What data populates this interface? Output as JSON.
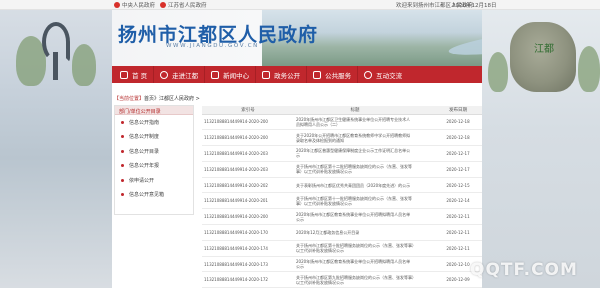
{
  "topbar": {
    "items": [
      "中央人民政府",
      "江苏省人民政府",
      "欢迎来到扬州市江都区人民政府",
      "2020年12月18日"
    ]
  },
  "banner": {
    "title": "扬州市江都区人民政府",
    "subtitle": "WWW.JIANGDU.GOV.CN",
    "stone_text": "江都"
  },
  "nav": {
    "items": [
      {
        "label": "首 页",
        "icon": "home-icon"
      },
      {
        "label": "走进江都",
        "icon": "info-icon"
      },
      {
        "label": "新闻中心",
        "icon": "news-icon"
      },
      {
        "label": "政务公开",
        "icon": "document-icon"
      },
      {
        "label": "公共服务",
        "icon": "service-icon"
      },
      {
        "label": "互动交流",
        "icon": "chat-icon"
      }
    ]
  },
  "breadcrumb": {
    "current": "【当前位置】",
    "path": "首页》江都区人民政府 >"
  },
  "sidebar": {
    "title": "部门/单位公开目录",
    "items": [
      "信息公开指南",
      "信息公开制度",
      "信息公开目录",
      "信息公开年报",
      "依申请公开",
      "信息公开意见箱"
    ]
  },
  "table": {
    "headers": [
      "索引号",
      "标题",
      "",
      "发布日期"
    ],
    "rows": [
      {
        "index": "11321088814449914-2020-200",
        "title": "2020年扬州市江都区卫生健康系统事业单位公开招聘专业技术人员拟聘用人员公示（二）",
        "date": "2020-12-18"
      },
      {
        "index": "11321088814449914-2020-200",
        "title": "关于2020年公开招聘市江都区教育系统教师中学公开招聘教师拟录取名单及体检报到的通知",
        "date": "2020-12-18"
      },
      {
        "index": "11321088814449914-2020-203",
        "title": "2020年江都区普惠型健康保障制度企业公示工作证明汇总名单公示",
        "date": "2020-12-17"
      },
      {
        "index": "11321088814449914-2020-203",
        "title": "关于扬州市江都区第十二批招聘服务缺岗位的公示（东营、张发等事）以工代训补贴发放情况公示",
        "date": "2020-12-17"
      },
      {
        "index": "11321088814449914-2020-202",
        "title": "关于表彰扬州市江都区优秀共青团团员（2020年度先进）的公示",
        "date": "2020-12-15"
      },
      {
        "index": "11321088814449914-2020-201",
        "title": "关于扬州市江都区第十一批招聘服务缺岗位的公示（东营、张发等事）以工代训补贴发放情况公示",
        "date": "2020-12-14"
      },
      {
        "index": "11321088814449914-2020-200",
        "title": "2020年扬州市江都区教育系统事业单位公开招聘拟聘用人员名单公示",
        "date": "2020-12-11"
      },
      {
        "index": "11321088814449914-2020-170",
        "title": "2020年12月江都政务信息公开目录",
        "date": "2020-12-11"
      },
      {
        "index": "11321088814449914-2020-174",
        "title": "关于扬州市江都区第十批招聘服务缺岗位的公示（东营、张发等事）以工代训补贴发放情况公示",
        "date": "2020-12-11"
      },
      {
        "index": "11321088814449914-2020-173",
        "title": "2020年扬州市江都区教育系统事业单位公开招聘拟聘用人员名单公示",
        "date": "2020-12-10"
      },
      {
        "index": "11321088814449914-2020-172",
        "title": "关于扬州市江都区第九批招聘服务缺岗位的公示（东营、张发等事）以工代训补贴发放情况公示",
        "date": "2020-12-09"
      }
    ]
  },
  "watermark": "QQTF.COM"
}
